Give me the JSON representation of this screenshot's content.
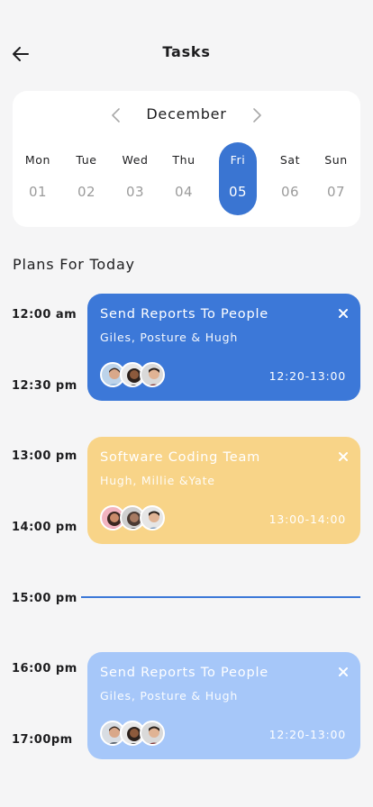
{
  "header": {
    "title": "Tasks",
    "back_icon": "arrow-left-icon"
  },
  "calendar": {
    "month": "December",
    "prev_icon": "chevron-left-icon",
    "next_icon": "chevron-right-icon",
    "days": [
      {
        "name": "Mon",
        "num": "01",
        "active": false
      },
      {
        "name": "Tue",
        "num": "02",
        "active": false
      },
      {
        "name": "Wed",
        "num": "03",
        "active": false
      },
      {
        "name": "Thu",
        "num": "04",
        "active": false
      },
      {
        "name": "Fri",
        "num": "05",
        "active": true
      },
      {
        "name": "Sat",
        "num": "06",
        "active": false
      },
      {
        "name": "Sun",
        "num": "07",
        "active": false
      }
    ],
    "active_color": "#3a75d2"
  },
  "plans": {
    "title": "Plans For Today",
    "times": [
      "12:00 am",
      "12:30 pm",
      "13:00 pm",
      "14:00 pm",
      "15:00 pm",
      "16:00 pm",
      "17:00pm"
    ],
    "cards": [
      {
        "title": "Send Reports To People",
        "members": "Giles, Posture & Hugh",
        "time": "12:20-13:00",
        "color": "#3c78d8",
        "close_icon": "close-icon"
      },
      {
        "title": "Software Coding Team",
        "members": "Hugh, Millie &Yate",
        "time": "13:00-14:00",
        "color": "#f8d488",
        "close_icon": "close-icon"
      },
      {
        "title": "Send Reports To People",
        "members": "Giles, Posture & Hugh",
        "time": "12:20-13:00",
        "color": "#a6c7f9",
        "close_icon": "close-icon"
      }
    ],
    "current_time_line_color": "#3c78d8"
  }
}
